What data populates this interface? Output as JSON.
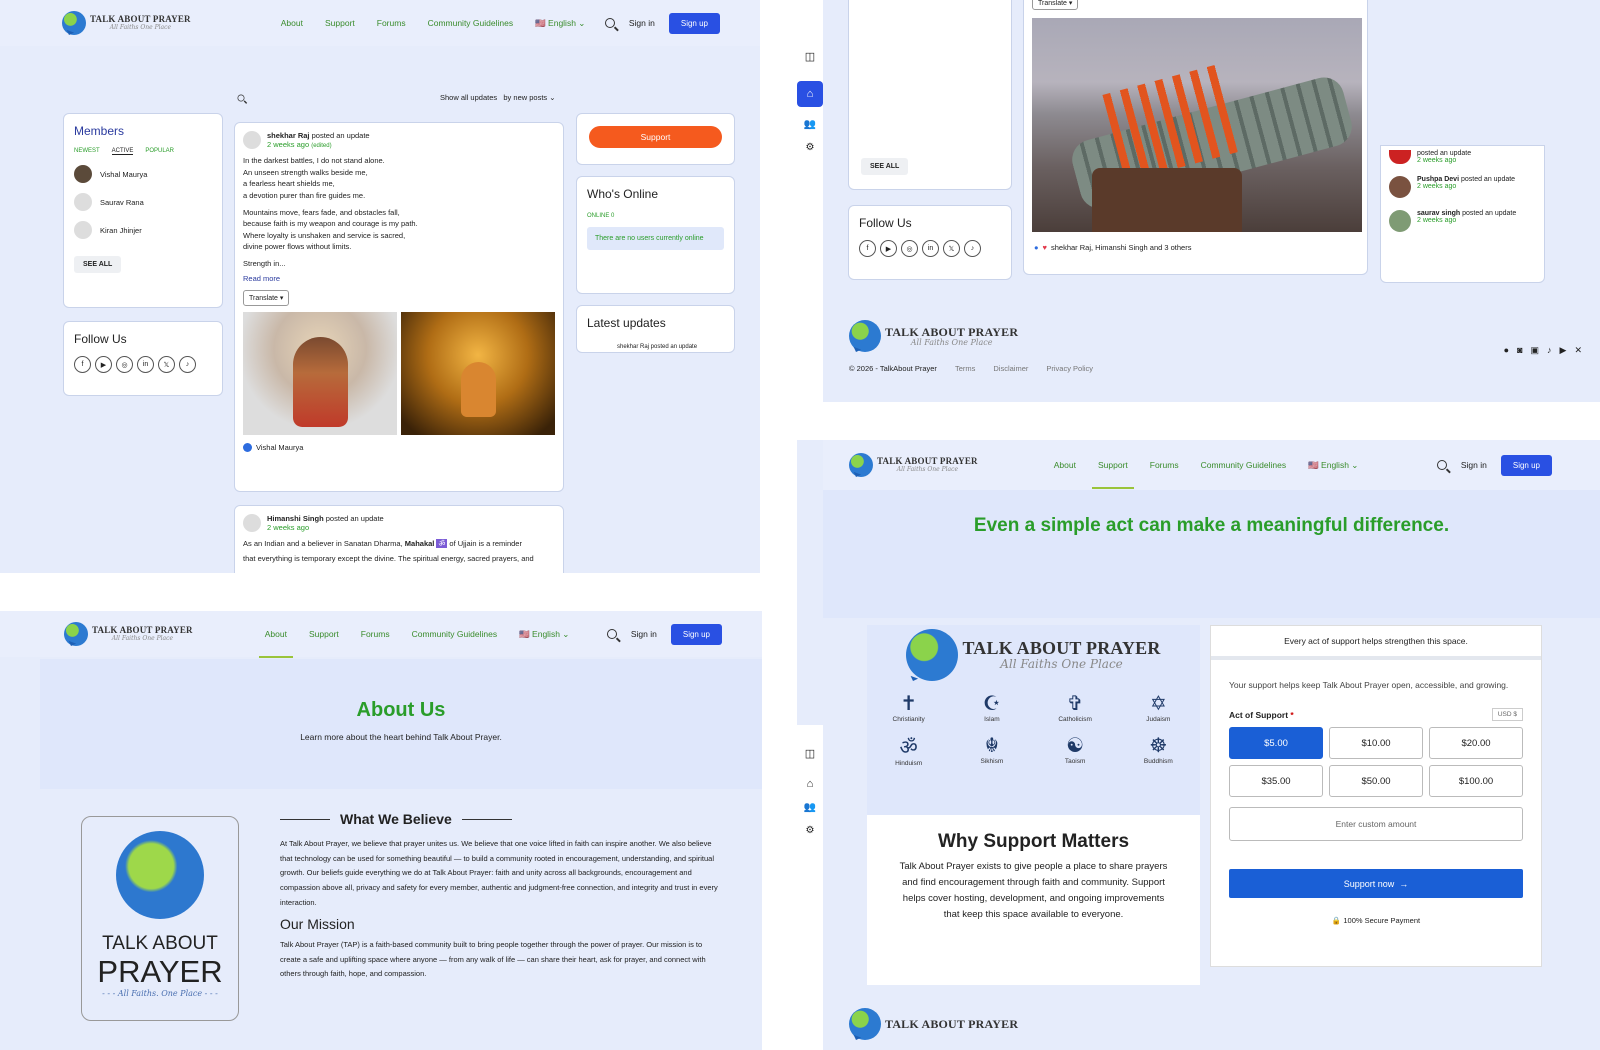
{
  "brand": {
    "title": "TALK ABOUT PRAYER",
    "tagline": "All Faiths One Place"
  },
  "nav": {
    "about": "About",
    "support": "Support",
    "forums": "Forums",
    "guidelines": "Community Guidelines",
    "language": "English",
    "sign_in": "Sign in",
    "sign_up": "Sign up"
  },
  "feed": {
    "show_label": "Show all updates",
    "sort_label": "by new posts",
    "members": {
      "title": "Members",
      "tabs": [
        "NEWEST",
        "ACTIVE",
        "POPULAR"
      ],
      "list": [
        "Vishal Maurya",
        "Saurav Rana",
        "Kiran Jhinjer"
      ],
      "see_all": "SEE ALL"
    },
    "follow_title": "Follow Us",
    "support_button": "Support",
    "whos_online": {
      "title": "Who's Online",
      "online_label": "ONLINE",
      "online_count": "0",
      "empty": "There are no users currently online"
    },
    "latest": {
      "title": "Latest updates",
      "item": "shekhar Raj posted an update"
    },
    "post1": {
      "author": "shekhar Raj",
      "action": "posted an update",
      "time": "2 weeks ago",
      "edited": "(edited)",
      "lines1": [
        "In the darkest battles, I do not stand alone.",
        "An unseen strength walks beside me,",
        "a fearless heart shields me,",
        "a devotion purer than fire guides me."
      ],
      "lines2": [
        "Mountains move, fears fade, and obstacles fall,",
        "because faith is my weapon and courage is my path.",
        "Where loyalty is unshaken and service is sacred,",
        "divine power flows without limits."
      ],
      "line3": "Strength in...",
      "read_more": "Read more",
      "translate": "Translate",
      "reaction": "Vishal Maurya"
    },
    "post2": {
      "author": "Himanshi Singh",
      "action": "posted an update",
      "time": "2 weeks ago",
      "text_a": "As an Indian and a believer in Sanatan Dharma,",
      "bold": "Mahakal",
      "text_b": "of Ujjain is a reminder",
      "text_c": "that everything is temporary except the divine. The spiritual energy, sacred prayers, and"
    }
  },
  "about": {
    "title": "About Us",
    "subtitle": "Learn more about the heart behind Talk About Prayer.",
    "logo_top": "TALK ABOUT",
    "logo_big": "PRAYER",
    "logo_tag": "- - - All Faiths. One Place - - -",
    "believe_title": "What We Believe",
    "believe_text": "At Talk About Prayer, we believe that prayer unites us. We believe that one voice lifted in faith can inspire another. We also believe that technology can be used for something beautiful — to build a community rooted in encouragement, understanding, and spiritual growth. Our beliefs guide everything we do at Talk About Prayer: faith and unity across all backgrounds, encouragement and compassion above all, privacy and safety for every member, authentic and judgment-free connection, and integrity and trust in every interaction.",
    "mission_title": "Our Mission",
    "mission_text": "Talk About Prayer (TAP) is a faith-based community built to bring people together through the power of prayer. Our mission is to create a safe and uplifting space where anyone — from any walk of life — can share their heart, ask for prayer, and connect with others through faith, hope, and compassion."
  },
  "feed2": {
    "translate": "Translate",
    "see_all": "SEE ALL",
    "follow_title": "Follow Us",
    "reaction": "shekhar Raj, Himanshi Singh and 3 others",
    "activity": [
      {
        "action": "posted an update",
        "time": "2 weeks ago"
      },
      {
        "name": "Pushpa Devi",
        "action": "posted an update",
        "time": "2 weeks ago"
      },
      {
        "name": "saurav singh",
        "action": "posted an update",
        "time": "2 weeks ago"
      }
    ],
    "copyright": "© 2026 - TalkAbout Prayer",
    "footer_links": [
      "Terms",
      "Disclaimer",
      "Privacy Policy"
    ]
  },
  "support": {
    "headline": "Even a simple act can make a meaningful difference.",
    "faiths": [
      "Christianity",
      "Islam",
      "Catholicism",
      "Judaism",
      "Hinduism",
      "Sikhism",
      "Taoism",
      "Buddhism"
    ],
    "why_title": "Why Support Matters",
    "why_text": "Talk About Prayer exists to give people a place to share prayers and find encouragement through faith and community. Support helps cover hosting, development, and ongoing improvements that keep this space available to everyone.",
    "form_header": "Every act of support helps strengthen this space.",
    "form_intro": "Your support helps keep Talk About Prayer open, accessible, and growing.",
    "act_label": "Act of Support",
    "currency": "USD $",
    "amounts": [
      "$5.00",
      "$10.00",
      "$20.00",
      "$35.00",
      "$50.00",
      "$100.00"
    ],
    "custom_placeholder": "Enter custom amount",
    "submit": "Support now",
    "secure": "100% Secure Payment",
    "footer_brand": "TALK ABOUT PRAYER"
  },
  "colors": {
    "accent_blue": "#2950e3",
    "green": "#2a9d2a",
    "orange": "#f55a1e",
    "bg": "#e6ecfb"
  }
}
